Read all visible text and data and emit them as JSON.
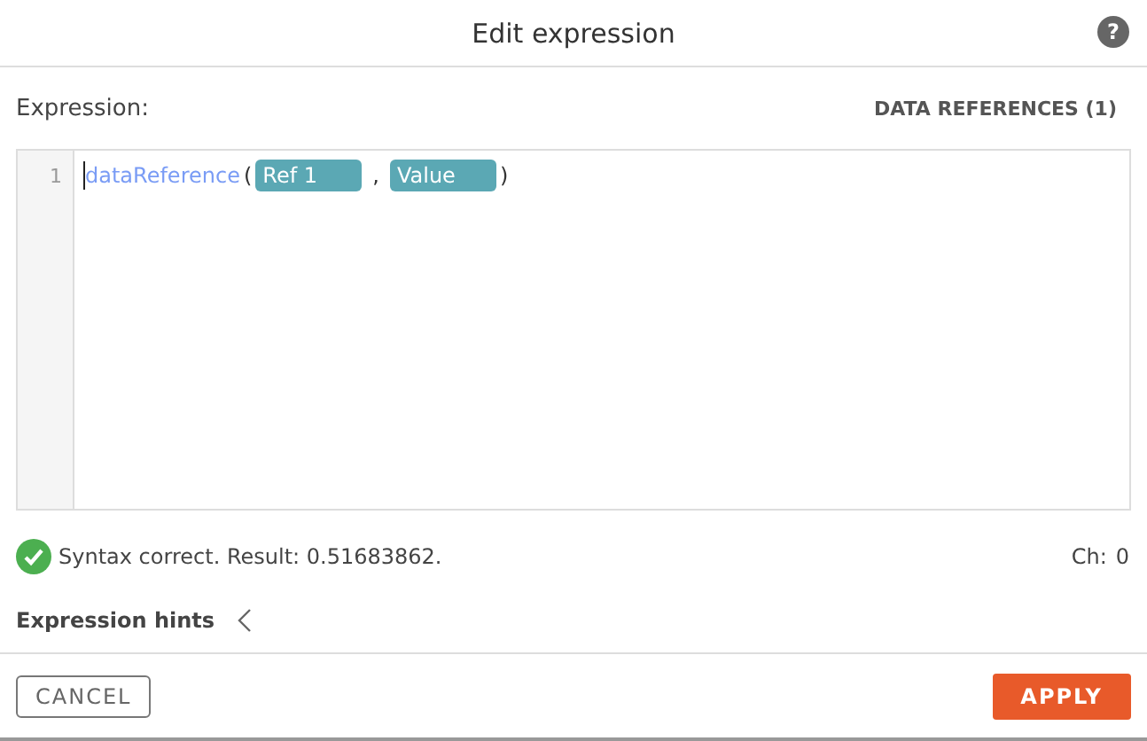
{
  "window": {
    "title": "Edit expression",
    "help": "?"
  },
  "expression": {
    "label": "Expression:",
    "data_references": "DATA REFERENCES (1)"
  },
  "editor": {
    "line_number": "1",
    "function": "dataReference",
    "open": "(",
    "separator": ",",
    "close": ")",
    "tokens": [
      "Ref 1",
      "Value"
    ]
  },
  "status": {
    "kind": "valid",
    "message": "Syntax correct. Result: 0.51683862.",
    "counter_label": "Ch:",
    "counter_value": "0"
  },
  "hints": {
    "label": "Expression hints",
    "expanded": false
  },
  "buttons": {
    "cancel": "CANCEL",
    "apply": "APPLY"
  }
}
